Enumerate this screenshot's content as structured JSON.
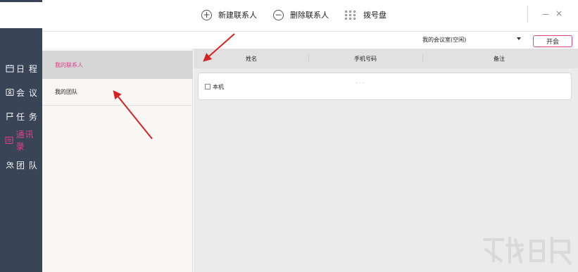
{
  "sidebar": {
    "items": [
      {
        "label": "日 程",
        "icon": "calendar-icon",
        "active": false
      },
      {
        "label": "会 议",
        "icon": "meeting-icon",
        "active": false
      },
      {
        "label": "任 务",
        "icon": "flag-icon",
        "active": false
      },
      {
        "label": "通讯录",
        "icon": "contacts-icon",
        "active": true
      },
      {
        "label": "团 队",
        "icon": "team-icon",
        "active": false
      }
    ]
  },
  "toolbar": {
    "new_contact": "新建联系人",
    "delete_contact": "删除联系人",
    "dialpad": "拨号盘",
    "minimize": "－",
    "close": "×"
  },
  "subbar": {
    "room_selected": "我的会议室(空闲)",
    "start_label": "开会"
  },
  "groups": [
    {
      "label": "我的联系人",
      "active": true
    },
    {
      "label": "我的团队",
      "active": false
    }
  ],
  "table": {
    "headers": [
      "姓名",
      "手机号码",
      "备注"
    ],
    "rows": [
      {
        "name": "本机",
        "phone": "· · ·"
      }
    ]
  },
  "colors": {
    "sidebar_bg": "#3a4457",
    "accent": "#e0408a",
    "arrow": "#d42323"
  }
}
